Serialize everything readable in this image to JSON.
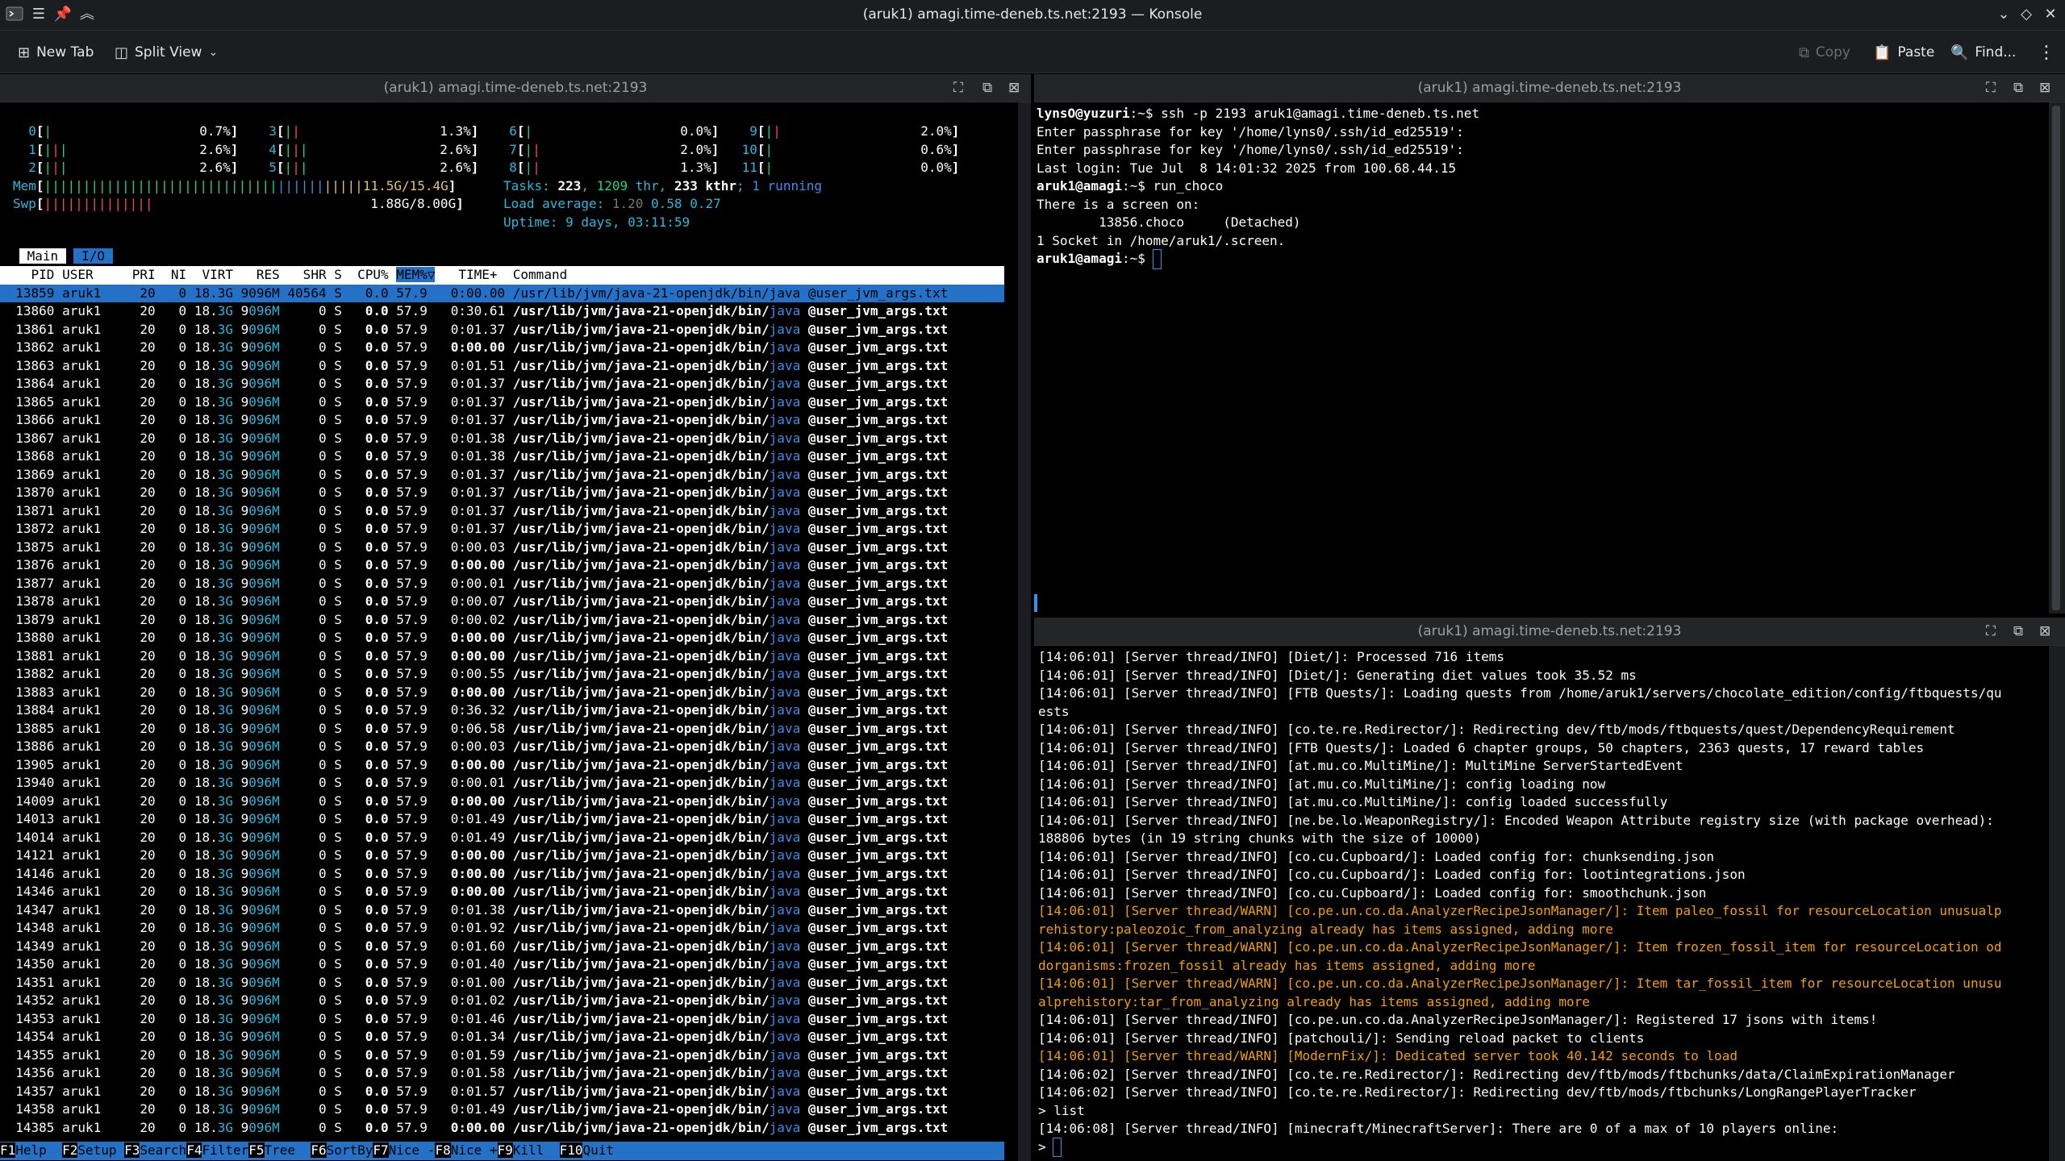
{
  "window": {
    "title": "(aruk1) amagi.time-deneb.ts.net:2193 — Konsole"
  },
  "toolbar": {
    "new_tab": "New Tab",
    "split_view": "Split View",
    "copy": "Copy",
    "paste": "Paste",
    "find": "Find..."
  },
  "panes": {
    "left_title": "(aruk1) amagi.time-deneb.ts.net:2193",
    "right_top_title": "(aruk1) amagi.time-deneb.ts.net:2193",
    "right_bottom_title": "(aruk1) amagi.time-deneb.ts.net:2193"
  },
  "htop": {
    "cpus": [
      {
        "id": "0",
        "pct": "0.7%"
      },
      {
        "id": "3",
        "pct": "1.3%"
      },
      {
        "id": "6",
        "pct": "0.0%"
      },
      {
        "id": "9",
        "pct": "2.0%"
      },
      {
        "id": "1",
        "pct": "2.6%"
      },
      {
        "id": "4",
        "pct": "2.6%"
      },
      {
        "id": "7",
        "pct": "2.0%"
      },
      {
        "id": "10",
        "pct": "0.6%"
      },
      {
        "id": "2",
        "pct": "2.6%"
      },
      {
        "id": "5",
        "pct": "2.6%"
      },
      {
        "id": "8",
        "pct": "1.3%"
      },
      {
        "id": "11",
        "pct": "0.0%"
      }
    ],
    "mem_label": "Mem",
    "mem_value": "11.5G/15.4G",
    "swp_label": "Swp",
    "swp_value": "1.88G/8.00G",
    "tasks_line": {
      "label": "Tasks: ",
      "tasks": "223",
      "sep1": ", ",
      "thr": "1209",
      "thr_label": " thr",
      "sep2": ", ",
      "kthr": "233",
      "kthr_label": " kthr",
      "sep3": "; ",
      "running": "1 running"
    },
    "load_line": {
      "label": "Load average: ",
      "l1": "1.20",
      "l5": "0.58",
      "l15": "0.27"
    },
    "uptime_line": "Uptime: 9 days, 03:11:59",
    "tabs": [
      "Main",
      "I/O"
    ],
    "header": {
      "pid": "PID",
      "user": "USER",
      "pri": "PRI",
      "ni": "NI",
      "virt": "VIRT",
      "res": "RES",
      "shr": "SHR",
      "s": "S",
      "cpu": "CPU%",
      "mem": "MEM%▽",
      "time": "TIME+",
      "cmd": "Command"
    },
    "selected": {
      "pid": "13859",
      "user": "aruk1",
      "pri": "20",
      "ni": "0",
      "virt": "18.3G",
      "res": "9096M",
      "shr": "40564",
      "s": "S",
      "cpu": "0.0",
      "mem": "57.9",
      "time": "0:00.00",
      "cmd": "/usr/lib/jvm/java-21-openjdk/bin/java @user_jvm_args.txt"
    },
    "cmd_prefix": "/usr/lib/jvm/java-21-openjdk/bin/",
    "cmd_java": "java",
    "cmd_args": " @user_jvm_args.txt",
    "rows": [
      {
        "pid": "13860",
        "time": "0:30.61"
      },
      {
        "pid": "13861",
        "time": "0:01.37"
      },
      {
        "pid": "13862",
        "time": "0:00.00"
      },
      {
        "pid": "13863",
        "time": "0:01.51"
      },
      {
        "pid": "13864",
        "time": "0:01.37"
      },
      {
        "pid": "13865",
        "time": "0:01.37"
      },
      {
        "pid": "13866",
        "time": "0:01.37"
      },
      {
        "pid": "13867",
        "time": "0:01.38"
      },
      {
        "pid": "13868",
        "time": "0:01.38"
      },
      {
        "pid": "13869",
        "time": "0:01.37"
      },
      {
        "pid": "13870",
        "time": "0:01.37"
      },
      {
        "pid": "13871",
        "time": "0:01.37"
      },
      {
        "pid": "13872",
        "time": "0:01.37"
      },
      {
        "pid": "13875",
        "time": "0:00.03"
      },
      {
        "pid": "13876",
        "time": "0:00.00"
      },
      {
        "pid": "13877",
        "time": "0:00.01"
      },
      {
        "pid": "13878",
        "time": "0:00.07"
      },
      {
        "pid": "13879",
        "time": "0:00.02"
      },
      {
        "pid": "13880",
        "time": "0:00.00"
      },
      {
        "pid": "13881",
        "time": "0:00.00"
      },
      {
        "pid": "13882",
        "time": "0:00.55"
      },
      {
        "pid": "13883",
        "time": "0:00.00"
      },
      {
        "pid": "13884",
        "time": "0:36.32"
      },
      {
        "pid": "13885",
        "time": "0:06.58"
      },
      {
        "pid": "13886",
        "time": "0:00.03"
      },
      {
        "pid": "13905",
        "time": "0:00.00"
      },
      {
        "pid": "13940",
        "time": "0:00.01"
      },
      {
        "pid": "14009",
        "time": "0:00.00"
      },
      {
        "pid": "14013",
        "time": "0:01.49"
      },
      {
        "pid": "14014",
        "time": "0:01.49"
      },
      {
        "pid": "14121",
        "time": "0:00.00"
      },
      {
        "pid": "14146",
        "time": "0:00.00"
      },
      {
        "pid": "14346",
        "time": "0:00.00"
      },
      {
        "pid": "14347",
        "time": "0:01.38"
      },
      {
        "pid": "14348",
        "time": "0:01.92"
      },
      {
        "pid": "14349",
        "time": "0:01.60"
      },
      {
        "pid": "14350",
        "time": "0:01.40"
      },
      {
        "pid": "14351",
        "time": "0:01.00"
      },
      {
        "pid": "14352",
        "time": "0:01.02"
      },
      {
        "pid": "14353",
        "time": "0:01.46"
      },
      {
        "pid": "14354",
        "time": "0:01.34"
      },
      {
        "pid": "14355",
        "time": "0:01.59"
      },
      {
        "pid": "14356",
        "time": "0:01.58"
      },
      {
        "pid": "14357",
        "time": "0:01.57"
      },
      {
        "pid": "14358",
        "time": "0:01.49"
      },
      {
        "pid": "14385",
        "time": "0:00.00"
      }
    ],
    "row_common": {
      "user": "aruk1",
      "pri": "20",
      "ni": "0",
      "virt_a": "18.",
      "virt_b": "3G",
      "res_a": "9",
      "res_b": "096M",
      "shr": "0",
      "s": "S",
      "cpu": "0.0",
      "mem": "57.9"
    },
    "fkeys": [
      {
        "k": "F1",
        "l": "Help"
      },
      {
        "k": "F2",
        "l": "Setup"
      },
      {
        "k": "F3",
        "l": "Search"
      },
      {
        "k": "F4",
        "l": "Filter"
      },
      {
        "k": "F5",
        "l": "Tree"
      },
      {
        "k": "F6",
        "l": "SortBy"
      },
      {
        "k": "F7",
        "l": "Nice -"
      },
      {
        "k": "F8",
        "l": "Nice +"
      },
      {
        "k": "F9",
        "l": "Kill"
      },
      {
        "k": "F10",
        "l": "Quit"
      }
    ]
  },
  "ssh": {
    "lines": [
      {
        "prompt": "lynsO@yuzuri",
        "rest": ":~$ ssh -p 2193 aruk1@amagi.time-deneb.ts.net"
      },
      {
        "prompt": "",
        "rest": "Enter passphrase for key '/home/lyns0/.ssh/id_ed25519':"
      },
      {
        "prompt": "",
        "rest": "Enter passphrase for key '/home/lyns0/.ssh/id_ed25519':"
      },
      {
        "prompt": "",
        "rest": "Last login: Tue Jul  8 14:01:32 2025 from 100.68.44.15"
      },
      {
        "prompt": "aruk1@amagi",
        "rest": ":~$ run_choco"
      },
      {
        "prompt": "",
        "rest": "There is a screen on:"
      },
      {
        "prompt": "",
        "rest": "        13856.choco     (Detached)"
      },
      {
        "prompt": "",
        "rest": "1 Socket in /home/aruk1/.screen."
      },
      {
        "prompt": "aruk1@amagi",
        "rest": ":~$ "
      }
    ]
  },
  "log": {
    "lines": [
      {
        "t": "[14:06:01] [Server thread/INFO] [Diet/]: Processed 716 items",
        "w": false
      },
      {
        "t": "[14:06:01] [Server thread/INFO] [Diet/]: Generating diet values took 35.52 ms",
        "w": false
      },
      {
        "t": "[14:06:01] [Server thread/INFO] [FTB Quests/]: Loading quests from /home/aruk1/servers/chocolate_edition/config/ftbquests/qu",
        "w": false
      },
      {
        "t": "ests",
        "w": false
      },
      {
        "t": "[14:06:01] [Server thread/INFO] [co.te.re.Redirector/]: Redirecting dev/ftb/mods/ftbquests/quest/DependencyRequirement",
        "w": false
      },
      {
        "t": "[14:06:01] [Server thread/INFO] [FTB Quests/]: Loaded 6 chapter groups, 50 chapters, 2363 quests, 17 reward tables",
        "w": false
      },
      {
        "t": "[14:06:01] [Server thread/INFO] [at.mu.co.MultiMine/]: MultiMine ServerStartedEvent",
        "w": false
      },
      {
        "t": "[14:06:01] [Server thread/INFO] [at.mu.co.MultiMine/]: config loading now",
        "w": false
      },
      {
        "t": "[14:06:01] [Server thread/INFO] [at.mu.co.MultiMine/]: config loaded successfully",
        "w": false
      },
      {
        "t": "[14:06:01] [Server thread/INFO] [ne.be.lo.WeaponRegistry/]: Encoded Weapon Attribute registry size (with package overhead):",
        "w": false
      },
      {
        "t": "188806 bytes (in 19 string chunks with the size of 10000)",
        "w": false
      },
      {
        "t": "[14:06:01] [Server thread/INFO] [co.cu.Cupboard/]: Loaded config for: chunksending.json",
        "w": false
      },
      {
        "t": "[14:06:01] [Server thread/INFO] [co.cu.Cupboard/]: Loaded config for: lootintegrations.json",
        "w": false
      },
      {
        "t": "[14:06:01] [Server thread/INFO] [co.cu.Cupboard/]: Loaded config for: smoothchunk.json",
        "w": false
      },
      {
        "t": "[14:06:01] [Server thread/WARN] [co.pe.un.co.da.AnalyzerRecipeJsonManager/]: Item paleo_fossil for resourceLocation unusualp",
        "w": true
      },
      {
        "t": "rehistory:paleozoic_from_analyzing already has items assigned, adding more",
        "w": true
      },
      {
        "t": "[14:06:01] [Server thread/WARN] [co.pe.un.co.da.AnalyzerRecipeJsonManager/]: Item frozen_fossil_item for resourceLocation od",
        "w": true
      },
      {
        "t": "dorganisms:frozen_fossil already has items assigned, adding more",
        "w": true
      },
      {
        "t": "[14:06:01] [Server thread/WARN] [co.pe.un.co.da.AnalyzerRecipeJsonManager/]: Item tar_fossil_item for resourceLocation unusu",
        "w": true
      },
      {
        "t": "alprehistory:tar_from_analyzing already has items assigned, adding more",
        "w": true
      },
      {
        "t": "[14:06:01] [Server thread/INFO] [co.pe.un.co.da.AnalyzerRecipeJsonManager/]: Registered 17 jsons with items!",
        "w": false
      },
      {
        "t": "[14:06:01] [Server thread/INFO] [patchouli/]: Sending reload packet to clients",
        "w": false
      },
      {
        "t": "[14:06:01] [Server thread/WARN] [ModernFix/]: Dedicated server took 40.142 seconds to load",
        "w": true
      },
      {
        "t": "[14:06:02] [Server thread/INFO] [co.te.re.Redirector/]: Redirecting dev/ftb/mods/ftbchunks/data/ClaimExpirationManager",
        "w": false
      },
      {
        "t": "[14:06:02] [Server thread/INFO] [co.te.re.Redirector/]: Redirecting dev/ftb/mods/ftbchunks/LongRangePlayerTracker",
        "w": false
      },
      {
        "t": "> list",
        "w": false
      },
      {
        "t": "[14:06:08] [Server thread/INFO] [minecraft/MinecraftServer]: There are 0 of a max of 10 players online:",
        "w": false
      },
      {
        "t": "> ",
        "w": false
      }
    ]
  }
}
